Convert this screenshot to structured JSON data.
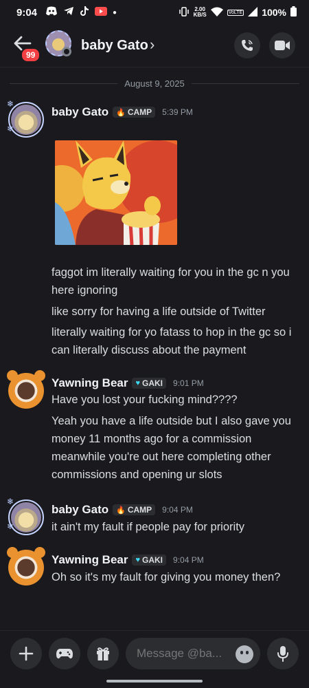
{
  "status_bar": {
    "time": "9:04",
    "speed_value": "2.00",
    "speed_unit": "KB/S",
    "volte": "VoLTE",
    "battery": "100%"
  },
  "header": {
    "title": "baby Gato",
    "chevron": "›",
    "unread_badge": "99"
  },
  "date_divider": "August 9, 2025",
  "messages": [
    {
      "author": "baby Gato",
      "tag": "CAMP",
      "time": "5:39 PM",
      "lines": [
        "faggot im literally waiting for you in the gc n you here ignoring",
        "like sorry for having a life outside of Twitter",
        "literally waiting for yo fatass to hop in the gc so i can literally discuss about the payment"
      ]
    },
    {
      "author": "Yawning Bear",
      "tag": "GAKI",
      "time": "9:01 PM",
      "lines": [
        "Have you lost your fucking mind????",
        "Yeah you have a life outside but I also gave you money 11 months ago for a commission meanwhile you're out here completing other commissions and opening ur slots"
      ]
    },
    {
      "author": "baby Gato",
      "tag": "CAMP",
      "time": "9:04 PM",
      "lines": [
        "it ain't my fault if people pay for priority"
      ]
    },
    {
      "author": "Yawning Bear",
      "tag": "GAKI",
      "time": "9:04 PM",
      "lines": [
        "Oh so it's my fault for giving you money then?"
      ]
    }
  ],
  "composer": {
    "placeholder": "Message @ba..."
  },
  "icons": {
    "back": "arrow-left-icon",
    "call": "phone-icon",
    "video": "video-camera-icon",
    "add": "plus-icon",
    "games": "gamepad-icon",
    "gift": "gift-icon",
    "emoji": "smiley-icon",
    "mic": "microphone-icon"
  },
  "colors": {
    "background": "#1a1a1e",
    "badge_red": "#f23f43",
    "tag_bg": "#2b2d31",
    "gaki_heart": "#3dd9f5",
    "camp_flame": "#f2903a"
  }
}
